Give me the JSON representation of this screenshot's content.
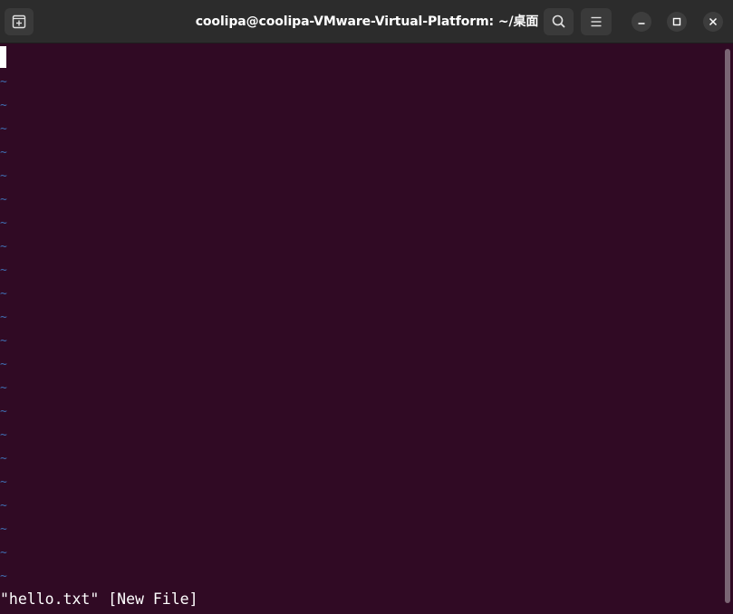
{
  "window": {
    "title": "coolipa@coolipa-VMware-Virtual-Platform: ~/桌面"
  },
  "header": {
    "icons": {
      "new_tab": "new-tab-icon",
      "search": "search-icon",
      "menu": "hamburger-menu-icon",
      "minimize": "minimize-icon",
      "maximize": "maximize-icon",
      "close": "close-icon"
    }
  },
  "terminal": {
    "empty_line_marker": "~",
    "status_message": "\"hello.txt\" [New File]"
  },
  "colors": {
    "terminal_background": "#300a24",
    "tilde": "#3f6db0",
    "headerbar": "#2c2c2c",
    "text": "#ffffff"
  }
}
